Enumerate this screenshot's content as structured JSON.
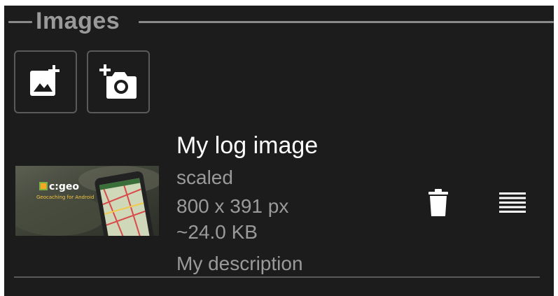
{
  "section": {
    "title": "Images"
  },
  "toolbar": {
    "add_image_icon": "add-photo-icon",
    "camera_icon": "add-camera-icon"
  },
  "image_item": {
    "title": "My log image",
    "status": "scaled",
    "dimensions": "800 x 391 px",
    "file_size": "~24.0 KB",
    "description": "My description",
    "thumbnail_text": "c:geo",
    "thumbnail_subtext": "Geocaching for Android"
  },
  "actions": {
    "delete_icon": "trash-icon",
    "menu_icon": "drag-handle-icon"
  },
  "colors": {
    "background": "#1c1c1c",
    "header_text": "#9a9a9a",
    "primary_text": "#ffffff",
    "secondary_text": "#9a9a9a",
    "divider": "#5a5a5a"
  }
}
